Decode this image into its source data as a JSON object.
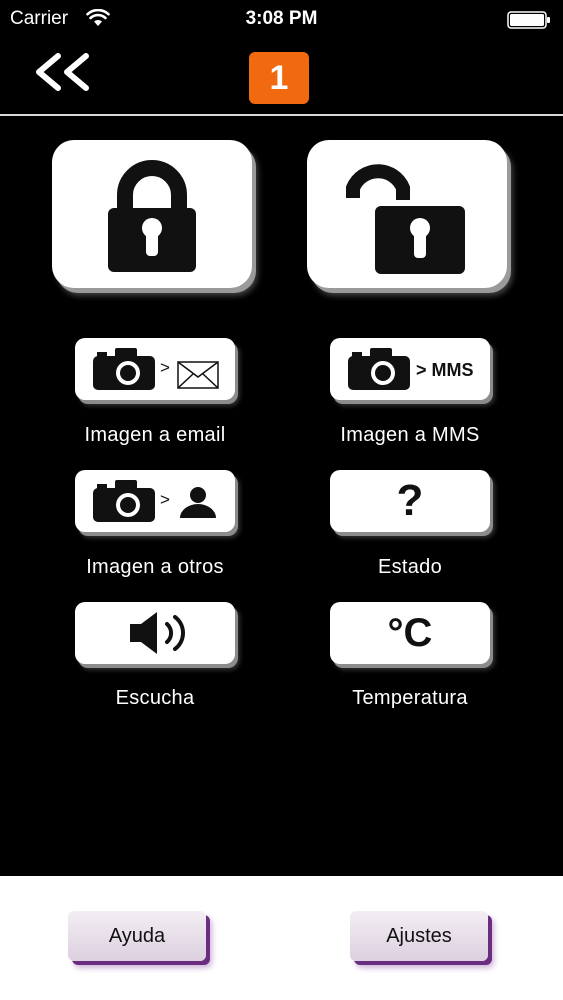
{
  "status_bar": {
    "carrier": "Carrier",
    "time": "3:08 PM",
    "icons": [
      "wifi-icon",
      "battery-icon"
    ]
  },
  "header": {
    "back_icon": "double-chevron-left-icon",
    "badge_number": "1",
    "badge_color": "#f26a0f"
  },
  "actions": {
    "lock": {
      "icon": "lock-closed-icon"
    },
    "unlock": {
      "icon": "lock-open-icon"
    }
  },
  "grid": [
    {
      "label": "Imagen a email",
      "icon": "camera-to-email-icon",
      "glyph": ">"
    },
    {
      "label": "Imagen a MMS",
      "icon": "camera-to-mms-icon",
      "glyph": "> MMS"
    },
    {
      "label": "Imagen a otros",
      "icon": "camera-to-person-icon",
      "glyph": ">"
    },
    {
      "label": "Estado",
      "icon": "question-icon",
      "glyph": "?"
    },
    {
      "label": "Escucha",
      "icon": "speaker-icon"
    },
    {
      "label": "Temperatura",
      "icon": "celsius-icon",
      "glyph": "°C"
    }
  ],
  "footer": {
    "help_label": "Ayuda",
    "settings_label": "Ajustes",
    "accent_color": "#6b2d80"
  }
}
